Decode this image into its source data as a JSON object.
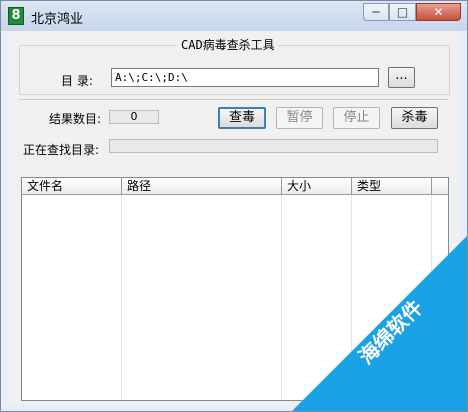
{
  "window": {
    "title": "北京鸿业",
    "minimize": "─",
    "maximize": "□",
    "close": "✕",
    "icon_glyph": "8"
  },
  "group": {
    "title": "CAD病毒查杀工具"
  },
  "directory": {
    "label": "目 录:",
    "value": "A:\\;C:\\;D:\\",
    "browse_label": "..."
  },
  "results": {
    "label": "结果数目:",
    "count": "0"
  },
  "buttons": {
    "scan": "查毒",
    "pause": "暂停",
    "stop": "停止",
    "kill": "杀毒"
  },
  "current_dir": {
    "label": "正在查找目录:",
    "value": ""
  },
  "table": {
    "columns": [
      "文件名",
      "路径",
      "大小",
      "类型"
    ]
  },
  "watermark": {
    "text": "海绵软件",
    "color": "#1aa2e6"
  }
}
